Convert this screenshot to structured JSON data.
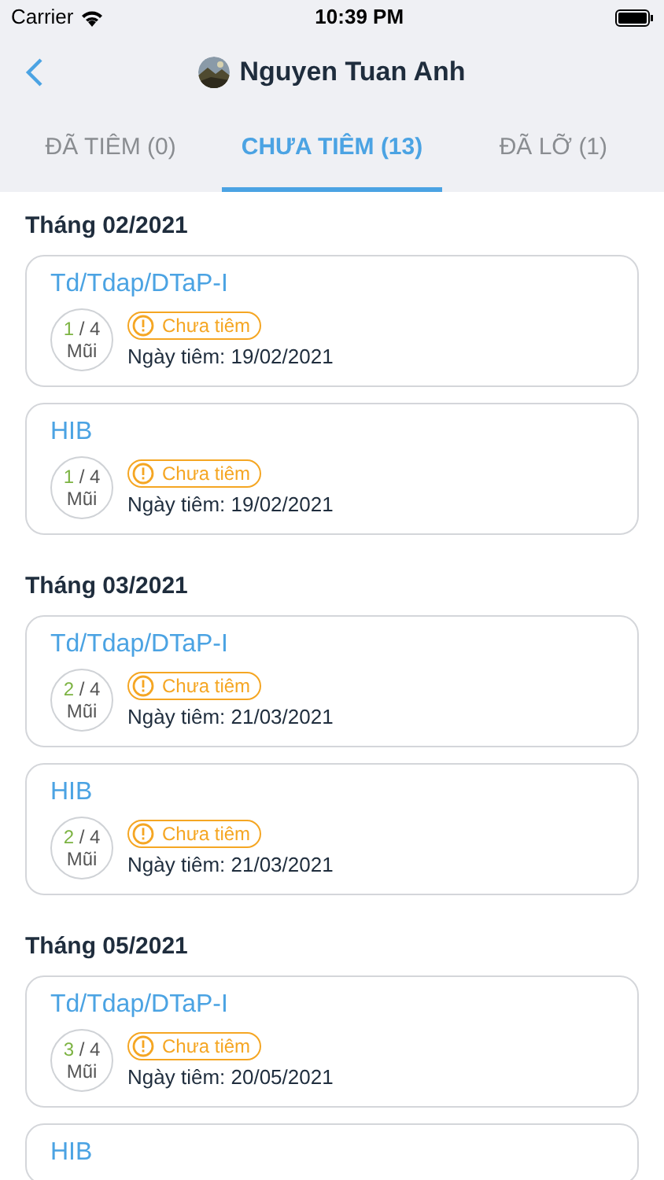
{
  "status_bar": {
    "carrier": "Carrier",
    "time": "10:39 PM"
  },
  "nav": {
    "title": "Nguyen Tuan Anh"
  },
  "tabs": [
    {
      "label": "ĐÃ TIÊM (0)",
      "selected": false
    },
    {
      "label": "CHƯA TIÊM (13)",
      "selected": true
    },
    {
      "label": "ĐÃ LỠ (1)",
      "selected": false
    }
  ],
  "sections": [
    {
      "heading": "Tháng 02/2021",
      "items": [
        {
          "name": "Td/Tdap/DTaP-I",
          "dose": "1",
          "total": "/ 4",
          "unit": "Mũi",
          "status": "Chưa tiêm",
          "date": "Ngày tiêm: 19/02/2021"
        },
        {
          "name": "HIB",
          "dose": "1",
          "total": "/ 4",
          "unit": "Mũi",
          "status": "Chưa tiêm",
          "date": "Ngày tiêm: 19/02/2021"
        }
      ]
    },
    {
      "heading": "Tháng 03/2021",
      "items": [
        {
          "name": "Td/Tdap/DTaP-I",
          "dose": "2",
          "total": "/ 4",
          "unit": "Mũi",
          "status": "Chưa tiêm",
          "date": "Ngày tiêm: 21/03/2021"
        },
        {
          "name": "HIB",
          "dose": "2",
          "total": "/ 4",
          "unit": "Mũi",
          "status": "Chưa tiêm",
          "date": "Ngày tiêm: 21/03/2021"
        }
      ]
    },
    {
      "heading": "Tháng 05/2021",
      "items": [
        {
          "name": "Td/Tdap/DTaP-I",
          "dose": "3",
          "total": "/ 4",
          "unit": "Mũi",
          "status": "Chưa tiêm",
          "date": "Ngày tiêm: 20/05/2021"
        },
        {
          "name": "HIB"
        }
      ]
    }
  ]
}
